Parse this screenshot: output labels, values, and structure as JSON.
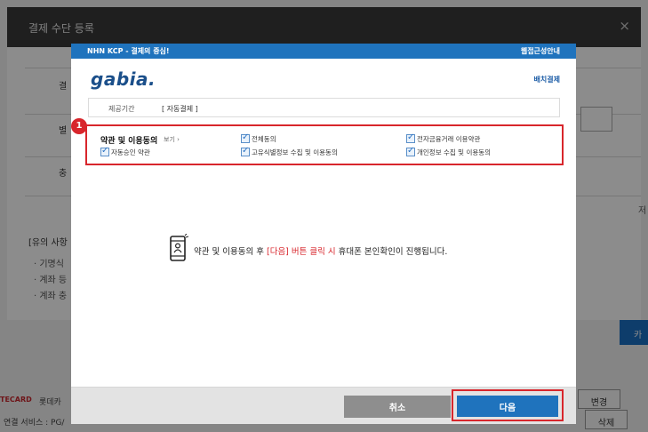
{
  "background": {
    "modal_title": "결제 수단 등록",
    "close_icon": "×",
    "row_labels": [
      "결",
      "별",
      "충"
    ],
    "notice_title": "[유의 사항",
    "notice_items": [
      "· 기명식",
      "· 계좌 등",
      "· 계좌 충"
    ],
    "side_char": "저",
    "blue_button": "카",
    "footer_brand": "TECARD",
    "footer_text_1": "롯데카",
    "footer_text_2": "연결 서비스 : PG/",
    "change_button": "변경",
    "delete_button": "삭제"
  },
  "popup": {
    "topbar_title": "NHN KCP - 결제의 중심!",
    "topbar_right": "웹접근성안내",
    "logo_text": "gabia",
    "logo_dot": ".",
    "batch_link": "배치결제",
    "period_label": "제공기간",
    "period_value": "[ 자동결제 ]",
    "badge": "1",
    "terms_title": "약관 및 이용동의",
    "terms_view": "보기 ›",
    "checkboxes": {
      "all_agree": "전체동의",
      "ecommerce_terms": "전자금융거래 이용약관",
      "autopay_terms": "자동승인 약관",
      "unique_id_consent": "고유식별정보 수집 및 이용동의",
      "privacy_consent": "개인정보 수집 및 이용동의"
    },
    "message_part1": "약관 및 이용동의 후 ",
    "message_red": "[다음] 버튼 클릭 시",
    "message_part2": " 휴대폰 본인확인이 진행됩니다.",
    "cancel_label": "취소",
    "next_label": "다음"
  },
  "colors": {
    "topbar_blue": "#1f73bd",
    "highlight_red": "#d8262c",
    "cancel_gray": "#8e8e8e"
  },
  "icons": {
    "phone": "phone-verification-icon",
    "checkbox": "checkbox-checked-icon"
  }
}
